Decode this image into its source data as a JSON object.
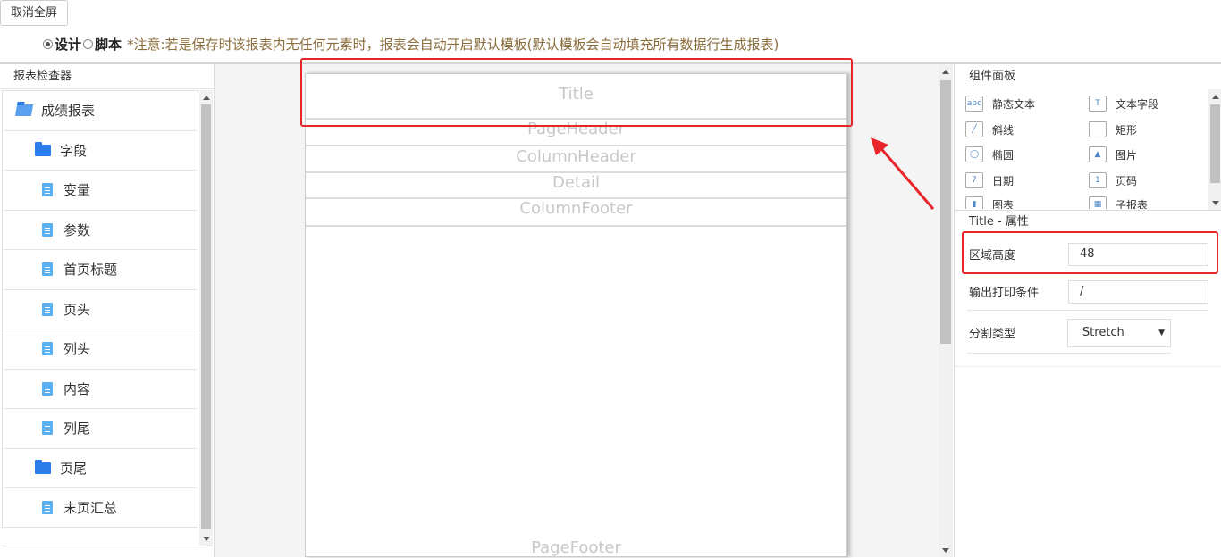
{
  "toolbar": {
    "exit_fullscreen_label": "取消全屏"
  },
  "mode": {
    "design_label": "设计",
    "script_label": "脚本",
    "selected": "设计",
    "notice": "*注意:若是保存时该报表内无任何元素时，报表会自动开启默认模板(默认模板会自动填充所有数据行生成报表)"
  },
  "inspector": {
    "title": "报表检查器",
    "items": [
      {
        "label": "成绩报表",
        "icon": "folder-open-icon"
      },
      {
        "label": "字段",
        "icon": "folder-icon"
      },
      {
        "label": "变量",
        "icon": "file-icon"
      },
      {
        "label": "参数",
        "icon": "file-icon"
      },
      {
        "label": "首页标题",
        "icon": "file-icon"
      },
      {
        "label": "页头",
        "icon": "file-icon"
      },
      {
        "label": "列头",
        "icon": "file-icon"
      },
      {
        "label": "内容",
        "icon": "file-icon"
      },
      {
        "label": "列尾",
        "icon": "file-icon"
      },
      {
        "label": "页尾",
        "icon": "folder-icon"
      },
      {
        "label": "末页汇总",
        "icon": "file-icon"
      }
    ]
  },
  "canvas": {
    "bands": {
      "title": "Title",
      "page_header": "PageHeader",
      "column_header": "ColumnHeader",
      "detail": "Detail",
      "column_footer": "ColumnFooter",
      "page_footer": "PageFooter"
    },
    "highlight_color": "#e8252a"
  },
  "components": {
    "title": "组件面板",
    "items": [
      {
        "label": "静态文本",
        "icon": "static-text-icon",
        "glyph": "abc"
      },
      {
        "label": "文本字段",
        "icon": "text-field-icon",
        "glyph": "T"
      },
      {
        "label": "斜线",
        "icon": "diagonal-line-icon",
        "glyph": "╱"
      },
      {
        "label": "矩形",
        "icon": "rectangle-icon",
        "glyph": ""
      },
      {
        "label": "椭圆",
        "icon": "ellipse-icon",
        "glyph": "◯"
      },
      {
        "label": "图片",
        "icon": "image-icon",
        "glyph": "▲"
      },
      {
        "label": "日期",
        "icon": "date-icon",
        "glyph": "7"
      },
      {
        "label": "页码",
        "icon": "page-number-icon",
        "glyph": "1"
      },
      {
        "label": "图表",
        "icon": "chart-icon",
        "glyph": "▮"
      },
      {
        "label": "子报表",
        "icon": "subreport-icon",
        "glyph": "▦"
      }
    ]
  },
  "properties": {
    "title": "Title - 属性",
    "height_label": "区域高度",
    "height_value": "48",
    "print_condition_label": "输出打印条件",
    "print_condition_value": "/",
    "split_type_label": "分割类型",
    "split_type_value": "Stretch"
  }
}
